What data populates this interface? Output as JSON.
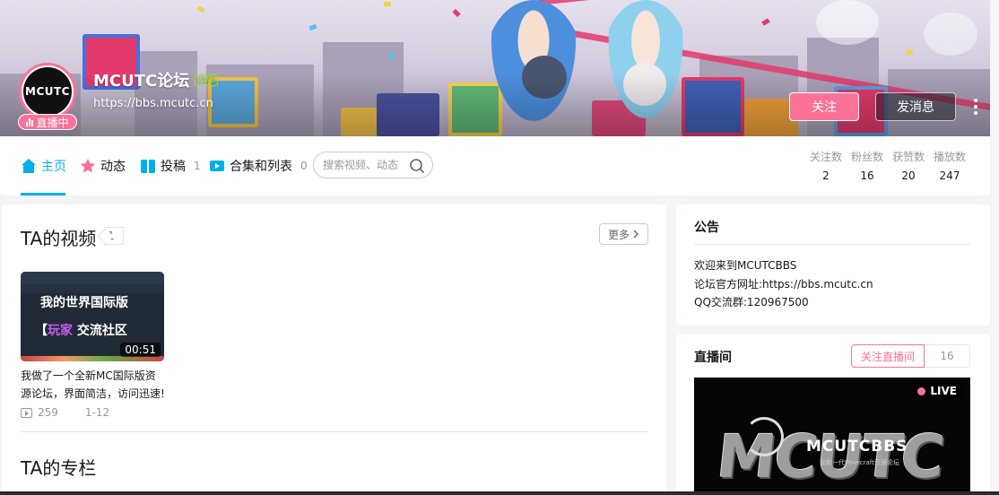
{
  "header": {
    "username": "MCUTC论坛",
    "level": "LV2",
    "sign": "https://bbs.mcutc.cn",
    "avatar_text": "MCUTC",
    "live_badge": "直播中",
    "follow_label": "关注",
    "message_label": "发消息"
  },
  "nav": {
    "items": [
      {
        "label": "主页",
        "count": "",
        "icon": "home-icon",
        "active": true
      },
      {
        "label": "动态",
        "count": "",
        "icon": "dynamic-icon"
      },
      {
        "label": "投稿",
        "count": "1",
        "icon": "upload-icon"
      },
      {
        "label": "合集和列表",
        "count": "0",
        "icon": "collection-icon"
      }
    ],
    "search_placeholder": "搜索视频、动态"
  },
  "stats": [
    {
      "label": "关注数",
      "value": "2"
    },
    {
      "label": "粉丝数",
      "value": "16"
    },
    {
      "label": "获赞数",
      "value": "20"
    },
    {
      "label": "播放数",
      "value": "247"
    }
  ],
  "videos_section": {
    "title": "TA的视频",
    "count": "1",
    "more_label": "更多",
    "videos": [
      {
        "thumb_line1": "我的世界国际版",
        "thumb_line2_pre": "【",
        "thumb_line2_hl": "玩家",
        "thumb_line2_post": " 交流社区",
        "duration": "00:51",
        "title": "我做了一个全新MC国际版资源论坛，界面简洁，访问迅速!",
        "plays": "259",
        "date": "1-12"
      }
    ]
  },
  "articles_section": {
    "title": "TA的专栏"
  },
  "notice": {
    "title": "公告",
    "lines": [
      "欢迎来到MCUTCBBS",
      "论坛官方网址:https://bbs.mcutc.cn",
      "QQ交流群:120967500"
    ]
  },
  "live_room": {
    "title": "直播间",
    "follow_label": "关注直播间",
    "count": "16",
    "live_tag": "LIVE",
    "cover_big": "MCUTC",
    "cover_mid": "MCUTCBBS",
    "cover_sub": "全新一代Minecraft资源论坛"
  },
  "colors": {
    "accent": "#00aeec",
    "pink": "#fb7299"
  }
}
